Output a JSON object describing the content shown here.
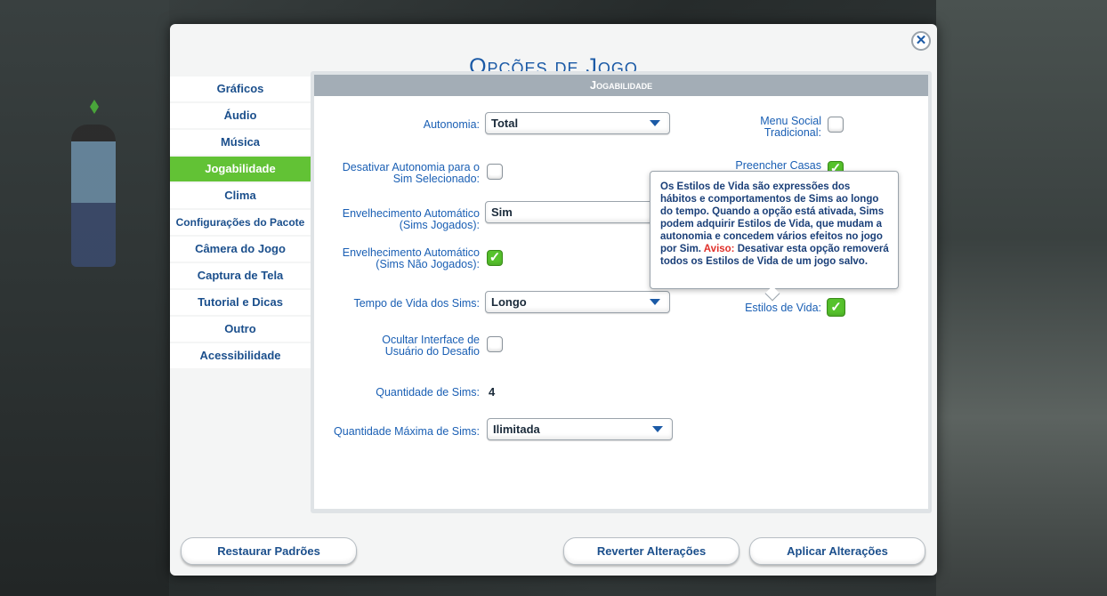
{
  "dialog": {
    "title": "Opções de Jogo",
    "close_icon": "close-icon"
  },
  "sidebar": {
    "items": [
      {
        "label": "Gráficos"
      },
      {
        "label": "Áudio"
      },
      {
        "label": "Música"
      },
      {
        "label": "Jogabilidade",
        "active": true
      },
      {
        "label": "Clima"
      },
      {
        "label": "Configurações do Pacote"
      },
      {
        "label": "Câmera do Jogo"
      },
      {
        "label": "Captura de Tela"
      },
      {
        "label": "Tutorial e Dicas"
      },
      {
        "label": "Outro"
      },
      {
        "label": "Acessibilidade"
      }
    ]
  },
  "section": {
    "header": "Jogabilidade"
  },
  "settings": {
    "autonomia": {
      "label": "Autonomia:",
      "value": "Total"
    },
    "desativar_autonomia": {
      "label_line1": "Desativar Autonomia para o",
      "label_line2": "Sim Selecionado:",
      "checked": false
    },
    "envelhecimento_jogados": {
      "label_line1": "Envelhecimento Automático",
      "label_line2": "(Sims Jogados):",
      "value": "Sim"
    },
    "envelhecimento_nao_jogados": {
      "label_line1": "Envelhecimento Automático",
      "label_line2": "(Sims Não Jogados):",
      "checked": true
    },
    "tempo_de_vida": {
      "label": "Tempo de Vida dos Sims:",
      "value": "Longo"
    },
    "ocultar_interface": {
      "label_line1": "Ocultar Interface de",
      "label_line2": "Usuário do Desafio",
      "checked": false
    },
    "quantidade_sims": {
      "label": "Quantidade de Sims:",
      "value": "4"
    },
    "quantidade_maxima": {
      "label": "Quantidade Máxima de Sims:",
      "value": "Ilimitada"
    },
    "menu_social": {
      "label_line1": "Menu Social",
      "label_line2": "Tradicional:",
      "checked": false
    },
    "preencher_casas": {
      "label": "Preencher Casas",
      "checked": true
    },
    "estilos_de_vida": {
      "label": "Estilos de Vida:",
      "checked": true
    }
  },
  "tooltip": {
    "text": "Os Estilos de Vida são expressões dos hábitos e comportamentos de Sims ao longo do tempo. Quando a opção está ativada, Sims podem adquirir Estilos de Vida, que mudam a autonomia e concedem vários efeitos no jogo por Sim.",
    "warning_label": "Aviso:",
    "warning_text": "Desativar esta opção removerá todos os Estilos de Vida de um jogo salvo."
  },
  "footer": {
    "restore_label": "Restaurar Padrões",
    "revert_label": "Reverter Alterações",
    "apply_label": "Aplicar Alterações"
  },
  "colors": {
    "accent_green": "#62c235",
    "title_blue": "#1b5aa6",
    "header_gray": "#a3adb6",
    "warning_red": "#e0302a"
  }
}
